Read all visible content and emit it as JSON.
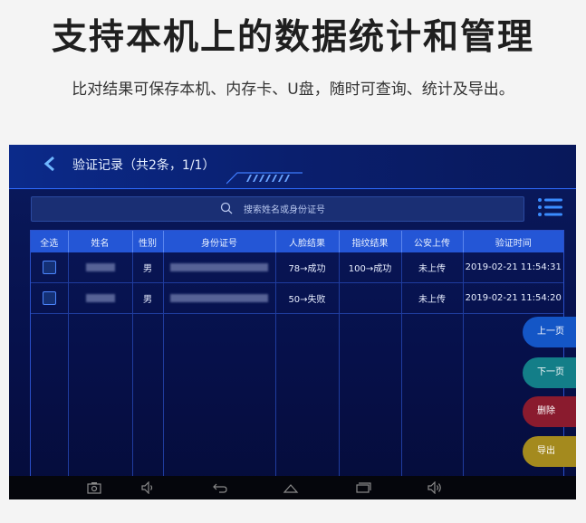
{
  "headline": "支持本机上的数据统计和管理",
  "subline": "比对结果可保存本机、内存卡、U盘，随时可查询、统计及导出。",
  "header": {
    "title": "验证记录（共2条，1/1）"
  },
  "search": {
    "placeholder": "搜索姓名或身份证号"
  },
  "table": {
    "columns": [
      "全选",
      "姓名",
      "性别",
      "身份证号",
      "人脸结果",
      "指纹结果",
      "公安上传",
      "验证时间"
    ],
    "rows": [
      {
        "gender": "男",
        "face": "78→成功",
        "fingerprint": "100→成功",
        "upload": "未上传",
        "time": "2019-02-21 11:54:31"
      },
      {
        "gender": "男",
        "face": "50→失败",
        "fingerprint": "",
        "upload": "未上传",
        "time": "2019-02-21 11:54:20"
      }
    ]
  },
  "buttons": {
    "prev": "上一页",
    "next": "下一页",
    "delete": "删除",
    "export": "导出"
  },
  "colors": {
    "accent": "#2456d6",
    "prev": "#1456c6",
    "next": "#137e88",
    "delete": "#8a1b2e",
    "export": "#a48a1e"
  },
  "icons": [
    "back-arrow-icon",
    "search-icon",
    "menu-icon",
    "camera-icon",
    "volume-down-icon",
    "back-icon",
    "home-icon",
    "recent-apps-icon",
    "volume-up-icon"
  ]
}
